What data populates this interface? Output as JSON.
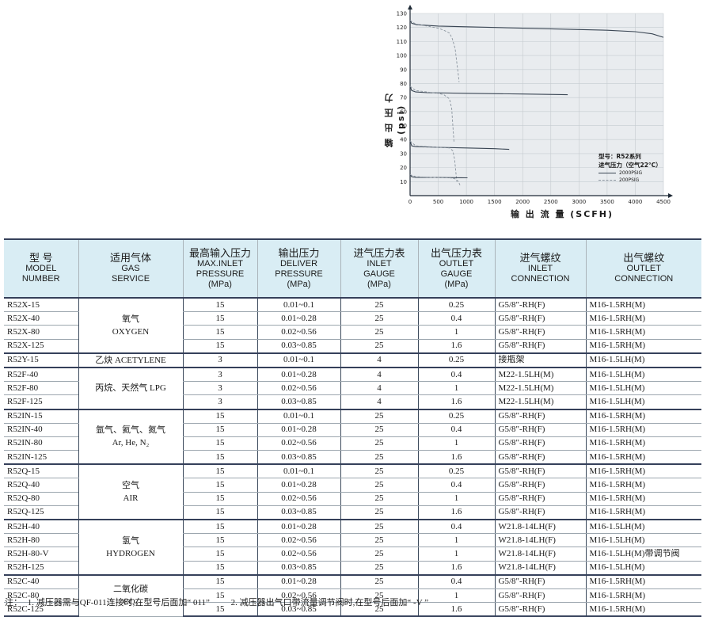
{
  "chart_data": {
    "type": "line",
    "xlabel": "输 出 流 量 (SCFH)",
    "ylabel": "输 出 压 力 (psi)",
    "xlim": [
      0,
      4500
    ],
    "ylim": [
      0,
      130
    ],
    "x_ticks": [
      "0",
      "500",
      "1000",
      "1500",
      "2000",
      "2500",
      "3000",
      "3500",
      "4000",
      "4500"
    ],
    "y_ticks": [
      "10",
      "20",
      "30",
      "40",
      "50",
      "60",
      "70",
      "80",
      "90",
      "100",
      "110",
      "120",
      "130"
    ],
    "legend": {
      "title_line1": "型号：R52系列",
      "title_line2": "进气压力（空气22°C）",
      "solid_label": "2000PSIG",
      "dashed_label": "200PSIG",
      "placement": "lower-right"
    },
    "series": [
      {
        "name": "2000PSIG",
        "style": "solid",
        "x": [
          0,
          30,
          120,
          500,
          1000,
          2000,
          3000,
          3500,
          4000,
          4300,
          4500
        ],
        "y": [
          125,
          123,
          122,
          121,
          120.5,
          119.5,
          118.5,
          118,
          117,
          115.5,
          113
        ]
      },
      {
        "name": "200PSIG",
        "style": "dashed",
        "x": [
          0,
          100,
          300,
          500,
          600,
          700,
          750,
          800,
          830,
          860,
          870
        ],
        "y": [
          125,
          122.5,
          121,
          119.5,
          118,
          116,
          112,
          105,
          95,
          85,
          81
        ]
      },
      {
        "name": "2000PSIG",
        "style": "solid",
        "x": [
          0,
          30,
          100,
          300,
          1000,
          2000,
          2800
        ],
        "y": [
          78,
          75,
          74,
          73.5,
          73,
          72.5,
          72
        ]
      },
      {
        "name": "200PSIG",
        "style": "dashed",
        "x": [
          0,
          100,
          300,
          500,
          600,
          700,
          740,
          760,
          780
        ],
        "y": [
          78,
          75,
          74,
          73,
          72,
          69,
          62,
          50,
          38
        ]
      },
      {
        "name": "2000PSIG",
        "style": "solid",
        "x": [
          0,
          30,
          100,
          500,
          1000,
          1500,
          1760
        ],
        "y": [
          39,
          35.5,
          35,
          34.5,
          34,
          33.5,
          33
        ]
      },
      {
        "name": "200PSIG",
        "style": "dashed",
        "x": [
          0,
          100,
          300,
          500,
          700,
          760,
          790,
          810,
          830
        ],
        "y": [
          39,
          35.5,
          35,
          34.5,
          34,
          32,
          26,
          18,
          10
        ]
      },
      {
        "name": "2000PSIG",
        "style": "solid",
        "x": [
          0,
          30,
          100,
          500,
          900,
          1020
        ],
        "y": [
          15,
          13.5,
          13,
          13,
          12.8,
          12.7
        ]
      },
      {
        "name": "200PSIG",
        "style": "dashed",
        "x": [
          0,
          100,
          400,
          700,
          800,
          860,
          890
        ],
        "y": [
          15,
          13.5,
          13,
          12.8,
          12,
          10,
          7
        ]
      }
    ]
  },
  "table": {
    "headers": [
      {
        "zh": "型 号",
        "en": [
          "MODEL",
          "NUMBER"
        ]
      },
      {
        "zh": "适用气体",
        "en": [
          "GAS",
          "SERVICE"
        ]
      },
      {
        "zh": "最高输入压力",
        "en": [
          "MAX.INLET",
          "PRESSURE",
          "(MPa)"
        ]
      },
      {
        "zh": "输出压力",
        "en": [
          "DELIVER",
          "PRESSURE",
          "(MPa)"
        ]
      },
      {
        "zh": "进气压力表",
        "en": [
          "INLET",
          "GAUGE",
          "(MPa)"
        ]
      },
      {
        "zh": "出气压力表",
        "en": [
          "OUTLET",
          "GAUGE",
          "(MPa)"
        ]
      },
      {
        "zh": "进气螺纹",
        "en": [
          "INLET",
          "CONNECTION"
        ]
      },
      {
        "zh": "出气螺纹",
        "en": [
          "OUTLET",
          "CONNECTION"
        ]
      }
    ],
    "groups": [
      {
        "gas_zh": "氧气",
        "gas_en": "OXYGEN",
        "rows": [
          {
            "model": "R52X-15",
            "max_inlet": "15",
            "deliver": "0.01~0.1",
            "inlet_gauge": "25",
            "outlet_gauge": "0.25",
            "inlet_conn": "G5/8\"-RH(F)",
            "outlet_conn": "M16-1.5RH(M)"
          },
          {
            "model": "R52X-40",
            "max_inlet": "15",
            "deliver": "0.01~0.28",
            "inlet_gauge": "25",
            "outlet_gauge": "0.4",
            "inlet_conn": "G5/8\"-RH(F)",
            "outlet_conn": "M16-1.5RH(M)"
          },
          {
            "model": "R52X-80",
            "max_inlet": "15",
            "deliver": "0.02~0.56",
            "inlet_gauge": "25",
            "outlet_gauge": "1",
            "inlet_conn": "G5/8\"-RH(F)",
            "outlet_conn": "M16-1.5RH(M)"
          },
          {
            "model": "R52X-125",
            "max_inlet": "15",
            "deliver": "0.03~0.85",
            "inlet_gauge": "25",
            "outlet_gauge": "1.6",
            "inlet_conn": "G5/8\"-RH(F)",
            "outlet_conn": "M16-1.5RH(M)"
          }
        ]
      },
      {
        "gas_zh": "乙炔 ACETYLENE",
        "gas_en": "",
        "rows": [
          {
            "model": "R52Y-15",
            "max_inlet": "3",
            "deliver": "0.01~0.1",
            "inlet_gauge": "4",
            "outlet_gauge": "0.25",
            "inlet_conn": "接瓶架",
            "outlet_conn": "M16-1.5LH(M)"
          }
        ]
      },
      {
        "gas_zh": "丙烷、天然气 LPG",
        "gas_en": "",
        "rows": [
          {
            "model": "R52F-40",
            "max_inlet": "3",
            "deliver": "0.01~0.28",
            "inlet_gauge": "4",
            "outlet_gauge": "0.4",
            "inlet_conn": "M22-1.5LH(M)",
            "outlet_conn": "M16-1.5LH(M)"
          },
          {
            "model": "R52F-80",
            "max_inlet": "3",
            "deliver": "0.02~0.56",
            "inlet_gauge": "4",
            "outlet_gauge": "1",
            "inlet_conn": "M22-1.5LH(M)",
            "outlet_conn": "M16-1.5LH(M)"
          },
          {
            "model": "R52F-125",
            "max_inlet": "3",
            "deliver": "0.03~0.85",
            "inlet_gauge": "4",
            "outlet_gauge": "1.6",
            "inlet_conn": "M22-1.5LH(M)",
            "outlet_conn": "M16-1.5LH(M)"
          }
        ]
      },
      {
        "gas_zh": "氩气、氦气、氮气",
        "gas_en": "Ar, He, N₂",
        "rows": [
          {
            "model": "R52IN-15",
            "max_inlet": "15",
            "deliver": "0.01~0.1",
            "inlet_gauge": "25",
            "outlet_gauge": "0.25",
            "inlet_conn": "G5/8\"-RH(F)",
            "outlet_conn": "M16-1.5RH(M)"
          },
          {
            "model": "R52IN-40",
            "max_inlet": "15",
            "deliver": "0.01~0.28",
            "inlet_gauge": "25",
            "outlet_gauge": "0.4",
            "inlet_conn": "G5/8\"-RH(F)",
            "outlet_conn": "M16-1.5RH(M)"
          },
          {
            "model": "R52IN-80",
            "max_inlet": "15",
            "deliver": "0.02~0.56",
            "inlet_gauge": "25",
            "outlet_gauge": "1",
            "inlet_conn": "G5/8\"-RH(F)",
            "outlet_conn": "M16-1.5RH(M)"
          },
          {
            "model": "R52IN-125",
            "max_inlet": "15",
            "deliver": "0.03~0.85",
            "inlet_gauge": "25",
            "outlet_gauge": "1.6",
            "inlet_conn": "G5/8\"-RH(F)",
            "outlet_conn": "M16-1.5RH(M)"
          }
        ]
      },
      {
        "gas_zh": "空气",
        "gas_en": "AIR",
        "rows": [
          {
            "model": "R52Q-15",
            "max_inlet": "15",
            "deliver": "0.01~0.1",
            "inlet_gauge": "25",
            "outlet_gauge": "0.25",
            "inlet_conn": "G5/8\"-RH(F)",
            "outlet_conn": "M16-1.5RH(M)"
          },
          {
            "model": "R52Q-40",
            "max_inlet": "15",
            "deliver": "0.01~0.28",
            "inlet_gauge": "25",
            "outlet_gauge": "0.4",
            "inlet_conn": "G5/8\"-RH(F)",
            "outlet_conn": "M16-1.5RH(M)"
          },
          {
            "model": "R52Q-80",
            "max_inlet": "15",
            "deliver": "0.02~0.56",
            "inlet_gauge": "25",
            "outlet_gauge": "1",
            "inlet_conn": "G5/8\"-RH(F)",
            "outlet_conn": "M16-1.5RH(M)"
          },
          {
            "model": "R52Q-125",
            "max_inlet": "15",
            "deliver": "0.03~0.85",
            "inlet_gauge": "25",
            "outlet_gauge": "1.6",
            "inlet_conn": "G5/8\"-RH(F)",
            "outlet_conn": "M16-1.5RH(M)"
          }
        ]
      },
      {
        "gas_zh": "氢气",
        "gas_en": "HYDROGEN",
        "rows": [
          {
            "model": "R52H-40",
            "max_inlet": "15",
            "deliver": "0.01~0.28",
            "inlet_gauge": "25",
            "outlet_gauge": "0.4",
            "inlet_conn": "W21.8-14LH(F)",
            "outlet_conn": "M16-1.5LH(M)"
          },
          {
            "model": "R52H-80",
            "max_inlet": "15",
            "deliver": "0.02~0.56",
            "inlet_gauge": "25",
            "outlet_gauge": "1",
            "inlet_conn": "W21.8-14LH(F)",
            "outlet_conn": "M16-1.5LH(M)"
          },
          {
            "model": "R52H-80-V",
            "max_inlet": "15",
            "deliver": "0.02~0.56",
            "inlet_gauge": "25",
            "outlet_gauge": "1",
            "inlet_conn": "W21.8-14LH(F)",
            "outlet_conn": "M16-1.5LH(M)带调节阀"
          },
          {
            "model": "R52H-125",
            "max_inlet": "15",
            "deliver": "0.03~0.85",
            "inlet_gauge": "25",
            "outlet_gauge": "1.6",
            "inlet_conn": "W21.8-14LH(F)",
            "outlet_conn": "M16-1.5LH(M)"
          }
        ]
      },
      {
        "gas_zh": "二氧化碳",
        "gas_en": "CO₂",
        "rows": [
          {
            "model": "R52C-40",
            "max_inlet": "15",
            "deliver": "0.01~0.28",
            "inlet_gauge": "25",
            "outlet_gauge": "0.4",
            "inlet_conn": "G5/8\"-RH(F)",
            "outlet_conn": "M16-1.5RH(M)"
          },
          {
            "model": "R52C-80",
            "max_inlet": "15",
            "deliver": "0.02~0.56",
            "inlet_gauge": "25",
            "outlet_gauge": "1",
            "inlet_conn": "G5/8\"-RH(F)",
            "outlet_conn": "M16-1.5RH(M)"
          },
          {
            "model": "R52C-125",
            "max_inlet": "15",
            "deliver": "0.03~0.85",
            "inlet_gauge": "25",
            "outlet_gauge": "1.6",
            "inlet_conn": "G5/8\"-RH(F)",
            "outlet_conn": "M16-1.5RH(M)"
          }
        ]
      }
    ]
  },
  "notes": {
    "prefix": "注：",
    "note1": "1. 减压器需与QF-011连接时,在型号后面加“ 011”",
    "note2": "2. 减压器出气口带流量调节阀时,在型号后面加“ -V ”"
  }
}
